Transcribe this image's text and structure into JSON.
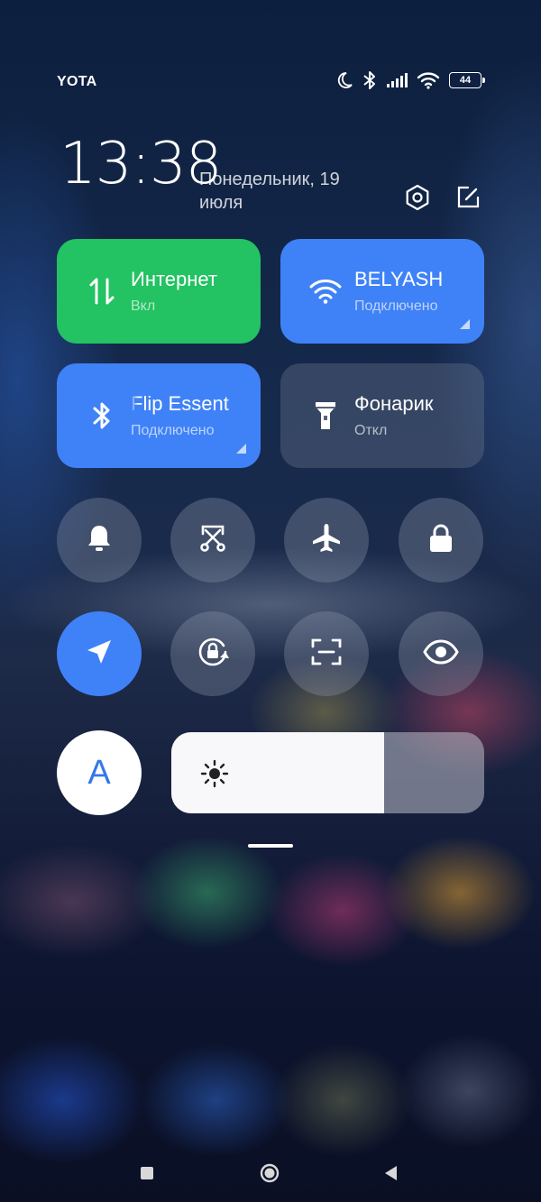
{
  "status_bar": {
    "carrier": "YOTA",
    "battery": "44",
    "icons": [
      "moon-icon",
      "bluetooth-icon",
      "signal-icon",
      "wifi-icon",
      "battery-icon"
    ]
  },
  "header": {
    "time": "13:38",
    "date": "Понедельник, 19 июля",
    "buttons": [
      "settings-icon",
      "edit-icon"
    ]
  },
  "tiles": [
    {
      "id": "internet",
      "title": "Интернет",
      "status": "Вкл",
      "color": "#23c262",
      "icon": "data-transfer-icon"
    },
    {
      "id": "wifi",
      "title": "BELYASH",
      "status": "Подключено",
      "color": "#3f82f7",
      "icon": "wifi-icon"
    },
    {
      "id": "bluetooth",
      "title": "Flip Essent",
      "status": "Подключено",
      "color": "#3f82f7",
      "icon": "bluetooth-icon"
    },
    {
      "id": "flashlight",
      "title": "Фонарик",
      "status": "Откл",
      "color": "#6f7790",
      "icon": "flashlight-icon"
    }
  ],
  "toggles_row1": [
    "bell-icon",
    "screenshot-scissors-icon",
    "airplane-icon",
    "lock-icon"
  ],
  "toggles_row2": [
    "location-icon",
    "rotation-lock-icon",
    "scan-icon",
    "eye-icon"
  ],
  "auto_brightness": {
    "label": "A",
    "icon": "auto-brightness-icon"
  },
  "brightness": {
    "level_percent": 68,
    "icon": "sun-icon"
  },
  "colors": {
    "accent_blue": "#3f82f7",
    "accent_green": "#23c262"
  }
}
